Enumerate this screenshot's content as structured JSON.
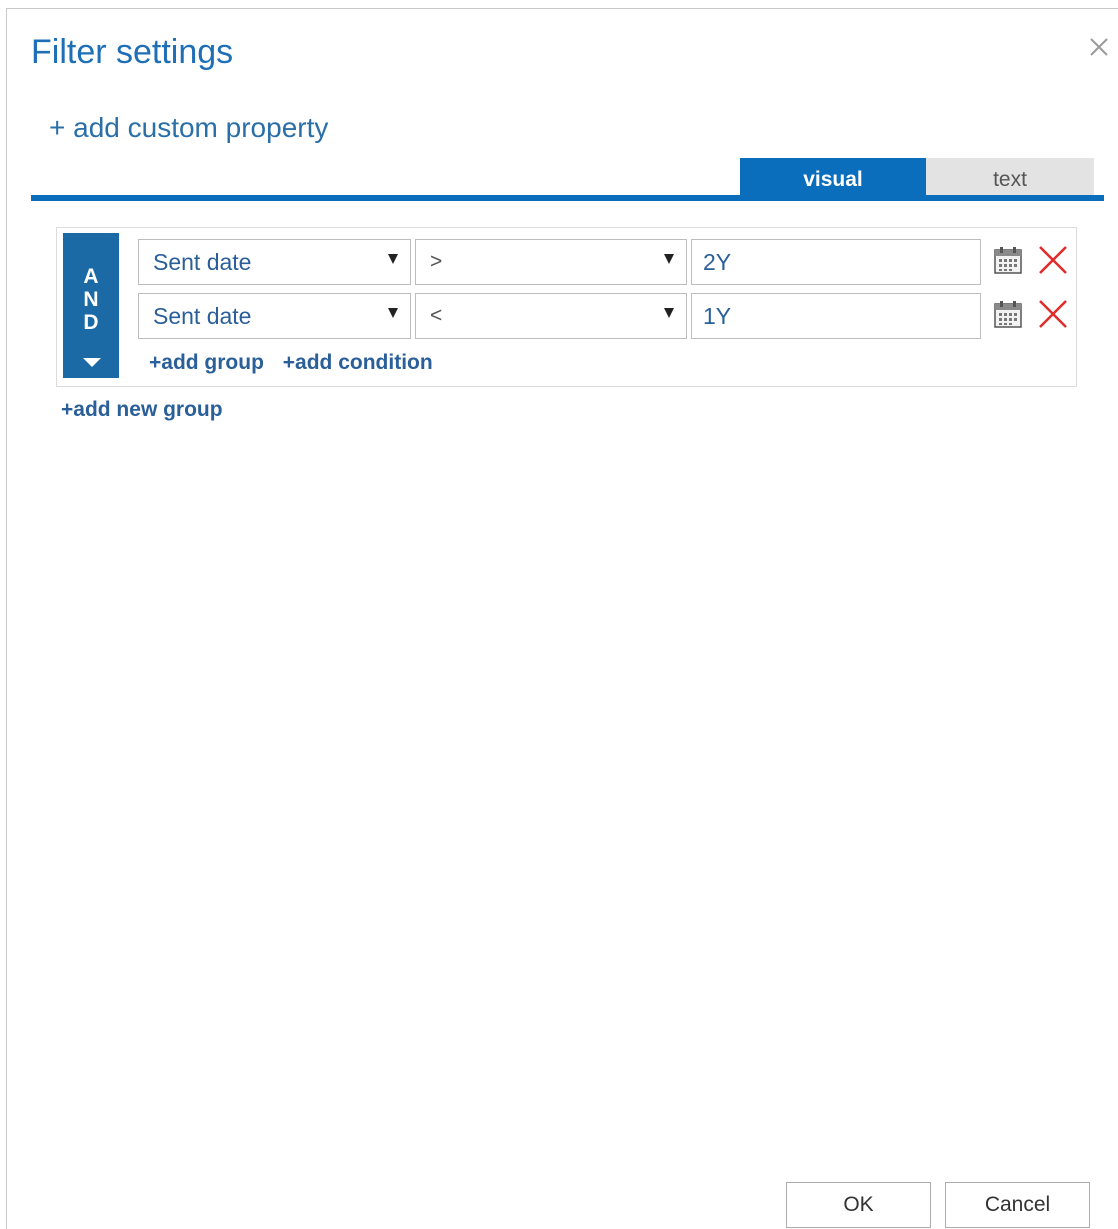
{
  "dialog": {
    "title": "Filter settings",
    "add_custom_property": "+ add custom property"
  },
  "tabs": [
    {
      "label": "visual",
      "active": true
    },
    {
      "label": "text",
      "active": false
    }
  ],
  "group": {
    "operator_letters": [
      "A",
      "N",
      "D"
    ],
    "conditions": [
      {
        "field": "Sent date",
        "operator": ">",
        "value": "2Y"
      },
      {
        "field": "Sent date",
        "operator": "<",
        "value": "1Y"
      }
    ],
    "add_group_label": "+add group",
    "add_condition_label": "+add condition"
  },
  "add_new_group_label": "+add new group",
  "footer": {
    "ok_label": "OK",
    "cancel_label": "Cancel"
  },
  "colors": {
    "accent": "#0a6ebd",
    "delete": "#e02b2b"
  }
}
